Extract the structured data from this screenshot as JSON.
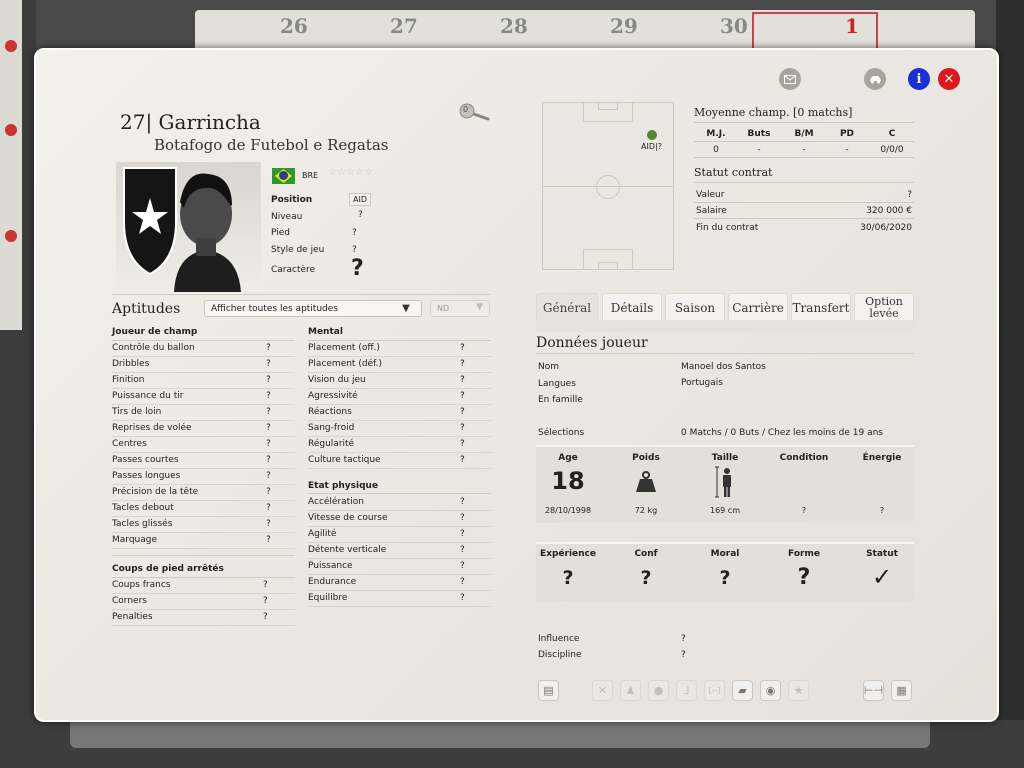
{
  "background": {
    "calendar_days": [
      "26",
      "27",
      "28",
      "29",
      "30",
      "1"
    ]
  },
  "header_buttons": {
    "mail_icon": "envelope-icon",
    "car_icon": "car-icon",
    "info_label": "i",
    "close_label": "✕"
  },
  "player": {
    "number": "27|",
    "name": "Garrincha",
    "club": "Botafogo de Futebol e Regatas",
    "zoom_badge": "0",
    "nationality": "BRE",
    "position_label": "Position",
    "position_value": "AID",
    "level_label": "Niveau",
    "level_value": "?",
    "foot_label": "Pied",
    "foot_value": "?",
    "style_label": "Style de jeu",
    "style_value": "?",
    "character_label": "Caractère",
    "character_value": "?"
  },
  "aptitudes": {
    "title": "Aptitudes",
    "dropdown_value": "Afficher toutes les aptitudes",
    "nd_value": "ND",
    "groups": {
      "field": {
        "title": "Joueur de champ",
        "items": [
          {
            "label": "Contrôle du ballon",
            "value": "?"
          },
          {
            "label": "Dribbles",
            "value": "?"
          },
          {
            "label": "Finition",
            "value": "?"
          },
          {
            "label": "Puissance du tir",
            "value": "?"
          },
          {
            "label": "Tirs de loin",
            "value": "?"
          },
          {
            "label": "Reprises de volée",
            "value": "?"
          },
          {
            "label": "Centres",
            "value": "?"
          },
          {
            "label": "Passes courtes",
            "value": "?"
          },
          {
            "label": "Passes longues",
            "value": "?"
          },
          {
            "label": "Précision de la tête",
            "value": "?"
          },
          {
            "label": "Tacles debout",
            "value": "?"
          },
          {
            "label": "Tacles glissés",
            "value": "?"
          },
          {
            "label": "Marquage",
            "value": "?"
          }
        ]
      },
      "setpieces": {
        "title": "Coups de pied arrêtés",
        "items": [
          {
            "label": "Coups francs",
            "value": "?"
          },
          {
            "label": "Corners",
            "value": "?"
          },
          {
            "label": "Penalties",
            "value": "?"
          }
        ]
      },
      "mental": {
        "title": "Mental",
        "items": [
          {
            "label": "Placement (off.)",
            "value": "?"
          },
          {
            "label": "Placement (déf.)",
            "value": "?"
          },
          {
            "label": "Vision du jeu",
            "value": "?"
          },
          {
            "label": "Agressivité",
            "value": "?"
          },
          {
            "label": "Réactions",
            "value": "?"
          },
          {
            "label": "Sang-froid",
            "value": "?"
          },
          {
            "label": "Régularité",
            "value": "?"
          },
          {
            "label": "Culture tactique",
            "value": "?"
          }
        ]
      },
      "physical": {
        "title": "Etat physique",
        "items": [
          {
            "label": "Accélération",
            "value": "?"
          },
          {
            "label": "Vitesse de course",
            "value": "?"
          },
          {
            "label": "Agilité",
            "value": "?"
          },
          {
            "label": "Détente verticale",
            "value": "?"
          },
          {
            "label": "Puissance",
            "value": "?"
          },
          {
            "label": "Endurance",
            "value": "?"
          },
          {
            "label": "Equilibre",
            "value": "?"
          }
        ]
      }
    }
  },
  "pitch": {
    "position_marker": "AID|?",
    "marker_color": "#4c8a2a"
  },
  "season": {
    "title": "Moyenne champ. [0 matchs]",
    "headers": [
      "M.J.",
      "Buts",
      "B/M",
      "PD",
      "C"
    ],
    "values": [
      "0",
      "-",
      "-",
      "-",
      "0/0/0"
    ]
  },
  "contract": {
    "title": "Statut contrat",
    "rows": [
      {
        "label": "Valeur",
        "value": "?"
      },
      {
        "label": "Salaire",
        "value": "320 000 €"
      },
      {
        "label": "Fin du contrat",
        "value": "30/06/2020"
      }
    ]
  },
  "tabs": [
    "Général",
    "Détails",
    "Saison",
    "Carrière",
    "Transfert",
    "Option levée"
  ],
  "player_data": {
    "title": "Données joueur",
    "rows": [
      {
        "label": "Nom",
        "value": "Manoel dos Santos"
      },
      {
        "label": "Langues",
        "value": "Portugais"
      },
      {
        "label": "En famille",
        "value": ""
      },
      {
        "label": "Sélections",
        "value": "0 Matchs / 0 Buts / Chez les moins de 19 ans"
      }
    ]
  },
  "physical_box": {
    "headers": [
      "Age",
      "Poids",
      "Taille",
      "Condition",
      "Énergie"
    ],
    "age": "18",
    "values": [
      "28/10/1998",
      "72 kg",
      "169 cm",
      "?",
      "?"
    ]
  },
  "mood_box": {
    "headers": [
      "Expérience",
      "Conf",
      "Moral",
      "Forme",
      "Statut"
    ],
    "values": [
      "?",
      "?",
      "?",
      "?",
      "✓"
    ]
  },
  "extra": {
    "rows": [
      {
        "label": "Influence",
        "value": "?"
      },
      {
        "label": "Discipline",
        "value": "?"
      }
    ]
  },
  "toolbar_icons": [
    "document-icon",
    "tactics-icon",
    "training-icon",
    "chat-icon",
    "kick-icon",
    "bracket-icon",
    "whistle-icon",
    "eye-icon",
    "star-icon",
    "dumbbell-icon",
    "report-icon"
  ],
  "colors": {
    "info": "#1a2fd6",
    "close": "#e0161c",
    "panel": "#efece7"
  }
}
